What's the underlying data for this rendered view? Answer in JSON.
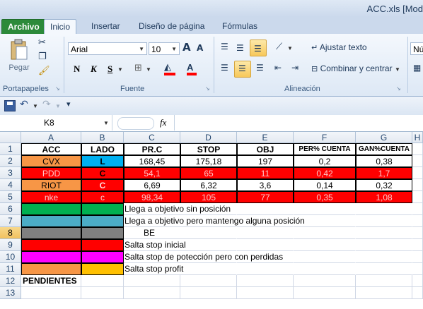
{
  "window": {
    "title": "ACC.xls  [Mod"
  },
  "tabs": [
    {
      "label": "Archivo"
    },
    {
      "label": "Inicio"
    },
    {
      "label": "Insertar"
    },
    {
      "label": "Diseño de página"
    },
    {
      "label": "Fórmulas"
    }
  ],
  "ribbon": {
    "clipboard": {
      "group_label": "Portapapeles",
      "paste_label": "Pegar"
    },
    "font": {
      "group_label": "Fuente",
      "font_name": "Arial",
      "font_size": "10",
      "bold": "N",
      "italic": "K",
      "underline": "S",
      "grow": "A",
      "shrink": "A"
    },
    "alignment": {
      "group_label": "Alineación",
      "wrap_label": "Ajustar texto",
      "merge_label": "Combinar y centrar"
    },
    "number": {
      "format_partial": "Nú"
    }
  },
  "formula_bar": {
    "name_box": "K8",
    "fx": "fx",
    "value": ""
  },
  "columns": [
    "A",
    "B",
    "C",
    "D",
    "E",
    "F",
    "G",
    "H"
  ],
  "selected_row": "8",
  "rows": [
    {
      "n": "1",
      "cells": [
        "ACC",
        "LADO",
        "PR.C",
        "STOP",
        "OBJ",
        "PER% CUENTA",
        "GAN%CUENTA"
      ]
    },
    {
      "n": "2",
      "cells": [
        "CVX",
        "L",
        "168,45",
        "175,18",
        "197",
        "0,2",
        "0,38"
      ]
    },
    {
      "n": "3",
      "cells": [
        "PDD",
        "C",
        "54,1",
        "65",
        "11",
        "0,42",
        "1,7"
      ]
    },
    {
      "n": "4",
      "cells": [
        "RIOT",
        "C",
        "6,69",
        "6,32",
        "3,6",
        "0,14",
        "0,32"
      ]
    },
    {
      "n": "5",
      "cells": [
        "nke",
        "c",
        "98,34",
        "105",
        "77",
        "0,35",
        "1,08"
      ]
    },
    {
      "n": "6",
      "legend": "Llega a objetivo sin posición"
    },
    {
      "n": "7",
      "legend": "Llega a objetivo pero mantengo alguna posición"
    },
    {
      "n": "8",
      "legend": "BE"
    },
    {
      "n": "9",
      "legend": "Salta stop inicial"
    },
    {
      "n": "10",
      "legend": "Salta stop de potección pero con perdidas"
    },
    {
      "n": "11",
      "legend": "Salta stop profit"
    },
    {
      "n": "12",
      "label": "PENDIENTES"
    },
    {
      "n": "13"
    }
  ],
  "colors": {
    "orange": "#f79646",
    "blue": "#00b0f0",
    "red": "#ff0000",
    "green": "#00b050",
    "teal": "#4bacc6",
    "gray": "#808080",
    "magenta": "#ff00ff",
    "gold": "#ffc000"
  }
}
